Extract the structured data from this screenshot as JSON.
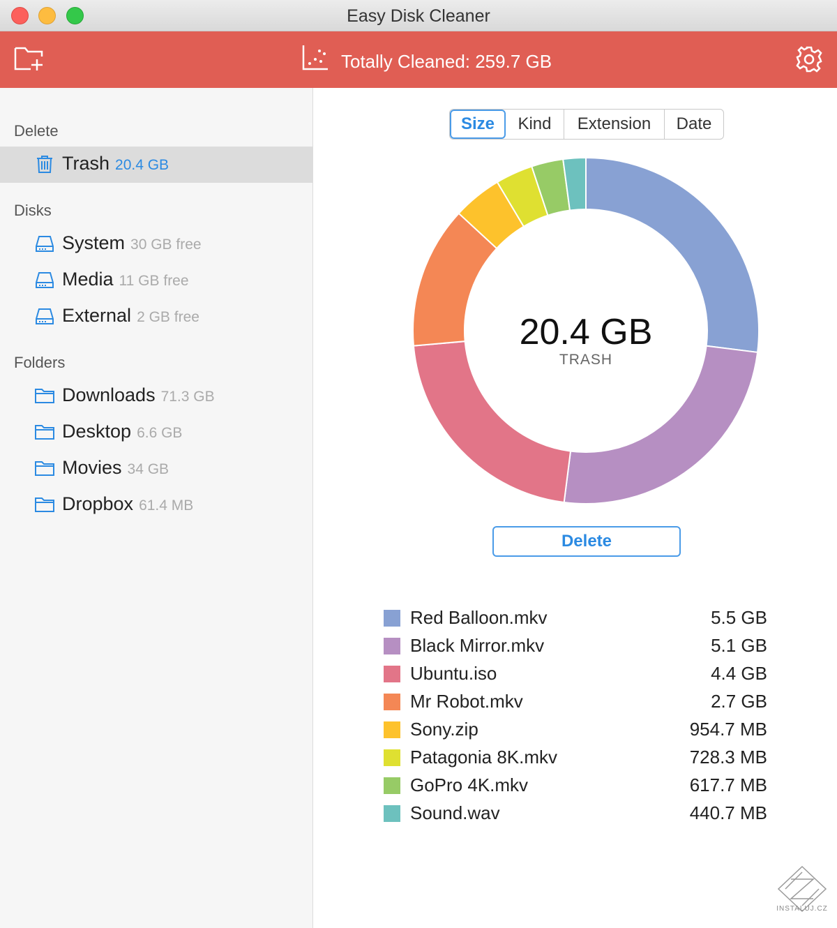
{
  "window": {
    "title": "Easy Disk Cleaner"
  },
  "toolbar": {
    "total_label": "Totally Cleaned: 259.7 GB",
    "add_folder_icon": "folder-add-icon",
    "stats_icon": "chart-icon",
    "settings_icon": "gear-icon",
    "bar_color": "#e05e54"
  },
  "sidebar": {
    "delete_section": {
      "title": "Delete",
      "items": [
        {
          "label": "Trash",
          "sub": "20.4 GB",
          "icon": "trash-icon",
          "selected": true
        }
      ]
    },
    "disks_section": {
      "title": "Disks",
      "items": [
        {
          "label": "System",
          "sub": "30 GB free",
          "icon": "disk-icon"
        },
        {
          "label": "Media",
          "sub": "11 GB free",
          "icon": "disk-icon"
        },
        {
          "label": "External",
          "sub": "2 GB free",
          "icon": "disk-icon"
        }
      ]
    },
    "folders_section": {
      "title": "Folders",
      "items": [
        {
          "label": "Downloads",
          "sub": "71.3 GB",
          "icon": "folder-icon"
        },
        {
          "label": "Desktop",
          "sub": "6.6 GB",
          "icon": "folder-icon"
        },
        {
          "label": "Movies",
          "sub": "34 GB",
          "icon": "folder-icon"
        },
        {
          "label": "Dropbox",
          "sub": "61.4 MB",
          "icon": "folder-icon"
        }
      ]
    }
  },
  "main": {
    "sort_tabs": [
      {
        "label": "Size",
        "active": true
      },
      {
        "label": "Kind",
        "active": false
      },
      {
        "label": "Extension",
        "active": false
      },
      {
        "label": "Date",
        "active": false
      }
    ],
    "center_value": "20.4 GB",
    "center_label": "TRASH",
    "delete_label": "Delete",
    "accent_color": "#2b8ae2",
    "files": [
      {
        "name": "Red Balloon.mkv",
        "size": "5.5 GB",
        "color": "#88a1d3"
      },
      {
        "name": "Black Mirror.mkv",
        "size": "5.1 GB",
        "color": "#b68fc2"
      },
      {
        "name": "Ubuntu.iso",
        "size": "4.4 GB",
        "color": "#e27588"
      },
      {
        "name": "Mr Robot.mkv",
        "size": "2.7 GB",
        "color": "#f48755"
      },
      {
        "name": "Sony.zip",
        "size": "954.7 MB",
        "color": "#fdc22c"
      },
      {
        "name": "Patagonia 8K.mkv",
        "size": "728.3 MB",
        "color": "#dfe031"
      },
      {
        "name": "GoPro 4K.mkv",
        "size": "617.7 MB",
        "color": "#97cb66"
      },
      {
        "name": "Sound.wav",
        "size": "440.7 MB",
        "color": "#6dc1be"
      }
    ]
  },
  "chart_data": {
    "type": "pie",
    "categories": [
      "Red Balloon.mkv",
      "Black Mirror.mkv",
      "Ubuntu.iso",
      "Mr Robot.mkv",
      "Sony.zip",
      "Patagonia 8K.mkv",
      "GoPro 4K.mkv",
      "Sound.wav"
    ],
    "values_mb": [
      5632,
      5222,
      4506,
      2765,
      954.7,
      728.3,
      617.7,
      440.7
    ],
    "colors": [
      "#88a1d3",
      "#b68fc2",
      "#e27588",
      "#f48755",
      "#fdc22c",
      "#dfe031",
      "#97cb66",
      "#6dc1be"
    ]
  },
  "watermark": {
    "text": "INSTALUJ.CZ"
  }
}
